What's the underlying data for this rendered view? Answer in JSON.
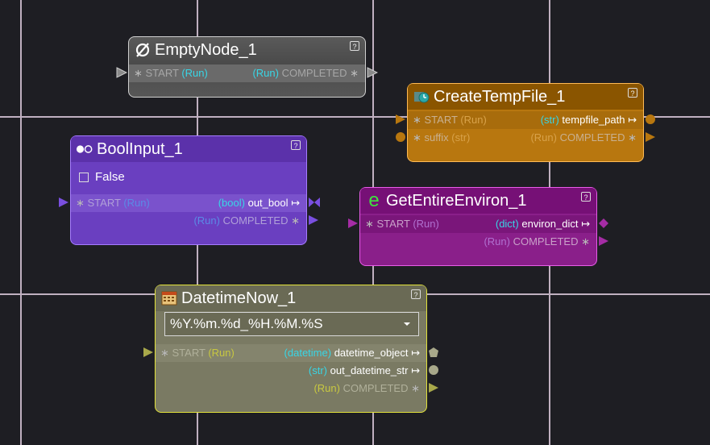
{
  "nodes": {
    "empty": {
      "title": "EmptyNode_1",
      "help": "?",
      "start": "START",
      "start_type": "(Run)",
      "completed": "COMPLETED",
      "completed_type": "(Run)"
    },
    "temp": {
      "title": "CreateTempFile_1",
      "help": "?",
      "start": "START",
      "start_type": "(Run)",
      "out_type": "(str)",
      "out_name": "tempfile_path",
      "suffix": "suffix",
      "suffix_type": "(str)",
      "completed": "COMPLETED",
      "completed_type": "(Run)"
    },
    "bool": {
      "title": "BoolInput_1",
      "help": "?",
      "checkbox_label": "False",
      "start": "START",
      "start_type": "(Run)",
      "out_type": "(bool)",
      "out_name": "out_bool",
      "completed": "COMPLETED",
      "completed_type": "(Run)"
    },
    "env": {
      "title": "GetEntireEnviron_1",
      "help": "?",
      "start": "START",
      "start_type": "(Run)",
      "out_type": "(dict)",
      "out_name": "environ_dict",
      "completed": "COMPLETED",
      "completed_type": "(Run)"
    },
    "dt": {
      "title": "DatetimeNow_1",
      "help": "?",
      "format_value": "%Y.%m.%d_%H.%M.%S",
      "start": "START",
      "start_type": "(Run)",
      "out1_type": "(datetime)",
      "out1_name": "datetime_object",
      "out2_type": "(str)",
      "out2_name": "out_datetime_str",
      "completed": "COMPLETED",
      "completed_type": "(Run)"
    }
  },
  "colors": {
    "background": "#1e1e23",
    "grid_line": "#b9a9b9",
    "type_text": "#38d6e6",
    "empty_border": "#cfcfcf",
    "temp_border": "#ffbb55",
    "bool_border": "#a67cff",
    "env_border": "#e85ce8",
    "dt_border": "#e2e23a"
  },
  "icons": {
    "empty": "empty-set-icon",
    "temp": "temp-file-icon",
    "bool": "toggle-icon",
    "env": "environ-e-icon",
    "dt": "calendar-icon"
  }
}
